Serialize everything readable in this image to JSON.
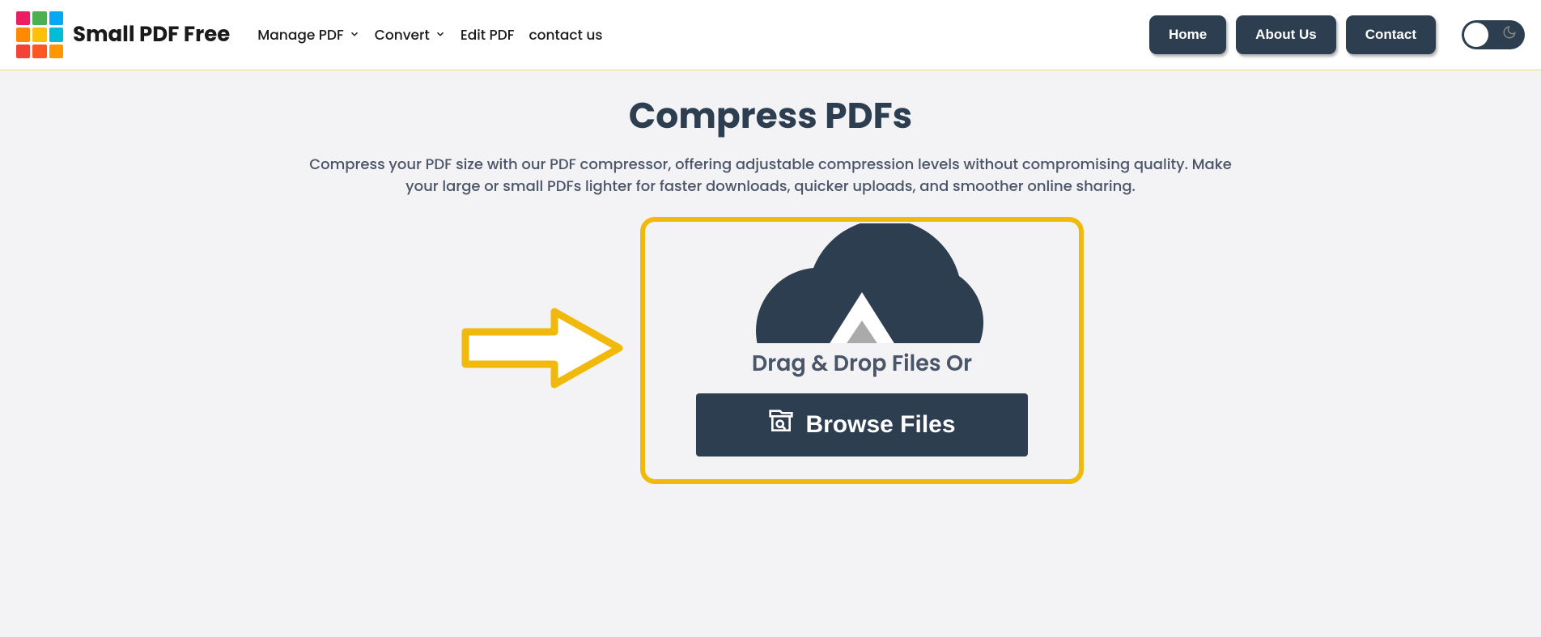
{
  "brand": {
    "name": "Small PDF Free",
    "logo_colors": [
      "#e91e63",
      "#4caf50",
      "#03a9f4",
      "#ff8a00",
      "#ffc107",
      "#00bcd4",
      "#f44336",
      "#ff5722",
      "#ff9800"
    ]
  },
  "nav": {
    "items": [
      {
        "label": "Manage PDF",
        "has_dropdown": true
      },
      {
        "label": "Convert",
        "has_dropdown": true
      },
      {
        "label": "Edit PDF",
        "has_dropdown": false
      },
      {
        "label": "contact us",
        "has_dropdown": false
      }
    ]
  },
  "header_buttons": {
    "home": "Home",
    "about": "About Us",
    "contact": "Contact"
  },
  "main": {
    "title": "Compress PDFs",
    "description": "Compress your PDF size with our PDF compressor, offering adjustable compression levels without compromising quality. Make your large or small PDFs lighter for faster downloads, quicker uploads, and smoother online sharing."
  },
  "upload": {
    "drop_text": "Drag & Drop Files Or",
    "browse_label": "Browse Files"
  },
  "colors": {
    "accent": "#f0b90b",
    "dark": "#2c3e50"
  }
}
